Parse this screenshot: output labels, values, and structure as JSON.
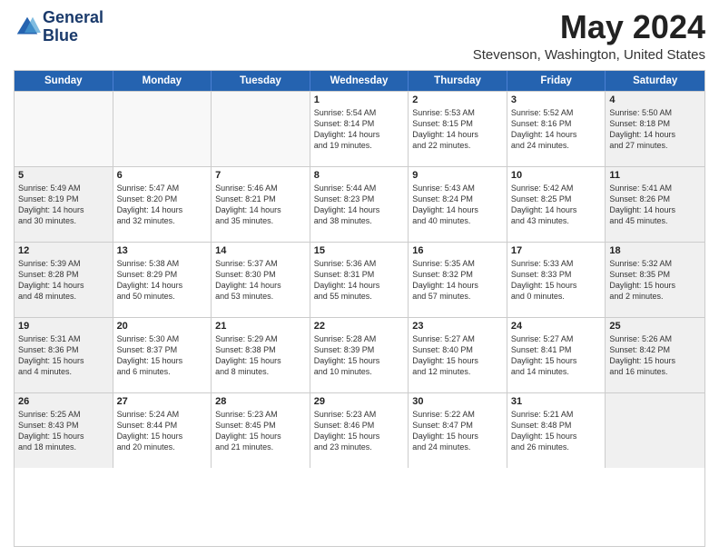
{
  "header": {
    "logo_line1": "General",
    "logo_line2": "Blue",
    "month": "May 2024",
    "location": "Stevenson, Washington, United States"
  },
  "weekdays": [
    "Sunday",
    "Monday",
    "Tuesday",
    "Wednesday",
    "Thursday",
    "Friday",
    "Saturday"
  ],
  "rows": [
    [
      {
        "day": "",
        "lines": [],
        "shaded": false
      },
      {
        "day": "",
        "lines": [],
        "shaded": false
      },
      {
        "day": "",
        "lines": [],
        "shaded": false
      },
      {
        "day": "1",
        "lines": [
          "Sunrise: 5:54 AM",
          "Sunset: 8:14 PM",
          "Daylight: 14 hours",
          "and 19 minutes."
        ],
        "shaded": false
      },
      {
        "day": "2",
        "lines": [
          "Sunrise: 5:53 AM",
          "Sunset: 8:15 PM",
          "Daylight: 14 hours",
          "and 22 minutes."
        ],
        "shaded": false
      },
      {
        "day": "3",
        "lines": [
          "Sunrise: 5:52 AM",
          "Sunset: 8:16 PM",
          "Daylight: 14 hours",
          "and 24 minutes."
        ],
        "shaded": false
      },
      {
        "day": "4",
        "lines": [
          "Sunrise: 5:50 AM",
          "Sunset: 8:18 PM",
          "Daylight: 14 hours",
          "and 27 minutes."
        ],
        "shaded": true
      }
    ],
    [
      {
        "day": "5",
        "lines": [
          "Sunrise: 5:49 AM",
          "Sunset: 8:19 PM",
          "Daylight: 14 hours",
          "and 30 minutes."
        ],
        "shaded": true
      },
      {
        "day": "6",
        "lines": [
          "Sunrise: 5:47 AM",
          "Sunset: 8:20 PM",
          "Daylight: 14 hours",
          "and 32 minutes."
        ],
        "shaded": false
      },
      {
        "day": "7",
        "lines": [
          "Sunrise: 5:46 AM",
          "Sunset: 8:21 PM",
          "Daylight: 14 hours",
          "and 35 minutes."
        ],
        "shaded": false
      },
      {
        "day": "8",
        "lines": [
          "Sunrise: 5:44 AM",
          "Sunset: 8:23 PM",
          "Daylight: 14 hours",
          "and 38 minutes."
        ],
        "shaded": false
      },
      {
        "day": "9",
        "lines": [
          "Sunrise: 5:43 AM",
          "Sunset: 8:24 PM",
          "Daylight: 14 hours",
          "and 40 minutes."
        ],
        "shaded": false
      },
      {
        "day": "10",
        "lines": [
          "Sunrise: 5:42 AM",
          "Sunset: 8:25 PM",
          "Daylight: 14 hours",
          "and 43 minutes."
        ],
        "shaded": false
      },
      {
        "day": "11",
        "lines": [
          "Sunrise: 5:41 AM",
          "Sunset: 8:26 PM",
          "Daylight: 14 hours",
          "and 45 minutes."
        ],
        "shaded": true
      }
    ],
    [
      {
        "day": "12",
        "lines": [
          "Sunrise: 5:39 AM",
          "Sunset: 8:28 PM",
          "Daylight: 14 hours",
          "and 48 minutes."
        ],
        "shaded": true
      },
      {
        "day": "13",
        "lines": [
          "Sunrise: 5:38 AM",
          "Sunset: 8:29 PM",
          "Daylight: 14 hours",
          "and 50 minutes."
        ],
        "shaded": false
      },
      {
        "day": "14",
        "lines": [
          "Sunrise: 5:37 AM",
          "Sunset: 8:30 PM",
          "Daylight: 14 hours",
          "and 53 minutes."
        ],
        "shaded": false
      },
      {
        "day": "15",
        "lines": [
          "Sunrise: 5:36 AM",
          "Sunset: 8:31 PM",
          "Daylight: 14 hours",
          "and 55 minutes."
        ],
        "shaded": false
      },
      {
        "day": "16",
        "lines": [
          "Sunrise: 5:35 AM",
          "Sunset: 8:32 PM",
          "Daylight: 14 hours",
          "and 57 minutes."
        ],
        "shaded": false
      },
      {
        "day": "17",
        "lines": [
          "Sunrise: 5:33 AM",
          "Sunset: 8:33 PM",
          "Daylight: 15 hours",
          "and 0 minutes."
        ],
        "shaded": false
      },
      {
        "day": "18",
        "lines": [
          "Sunrise: 5:32 AM",
          "Sunset: 8:35 PM",
          "Daylight: 15 hours",
          "and 2 minutes."
        ],
        "shaded": true
      }
    ],
    [
      {
        "day": "19",
        "lines": [
          "Sunrise: 5:31 AM",
          "Sunset: 8:36 PM",
          "Daylight: 15 hours",
          "and 4 minutes."
        ],
        "shaded": true
      },
      {
        "day": "20",
        "lines": [
          "Sunrise: 5:30 AM",
          "Sunset: 8:37 PM",
          "Daylight: 15 hours",
          "and 6 minutes."
        ],
        "shaded": false
      },
      {
        "day": "21",
        "lines": [
          "Sunrise: 5:29 AM",
          "Sunset: 8:38 PM",
          "Daylight: 15 hours",
          "and 8 minutes."
        ],
        "shaded": false
      },
      {
        "day": "22",
        "lines": [
          "Sunrise: 5:28 AM",
          "Sunset: 8:39 PM",
          "Daylight: 15 hours",
          "and 10 minutes."
        ],
        "shaded": false
      },
      {
        "day": "23",
        "lines": [
          "Sunrise: 5:27 AM",
          "Sunset: 8:40 PM",
          "Daylight: 15 hours",
          "and 12 minutes."
        ],
        "shaded": false
      },
      {
        "day": "24",
        "lines": [
          "Sunrise: 5:27 AM",
          "Sunset: 8:41 PM",
          "Daylight: 15 hours",
          "and 14 minutes."
        ],
        "shaded": false
      },
      {
        "day": "25",
        "lines": [
          "Sunrise: 5:26 AM",
          "Sunset: 8:42 PM",
          "Daylight: 15 hours",
          "and 16 minutes."
        ],
        "shaded": true
      }
    ],
    [
      {
        "day": "26",
        "lines": [
          "Sunrise: 5:25 AM",
          "Sunset: 8:43 PM",
          "Daylight: 15 hours",
          "and 18 minutes."
        ],
        "shaded": true
      },
      {
        "day": "27",
        "lines": [
          "Sunrise: 5:24 AM",
          "Sunset: 8:44 PM",
          "Daylight: 15 hours",
          "and 20 minutes."
        ],
        "shaded": false
      },
      {
        "day": "28",
        "lines": [
          "Sunrise: 5:23 AM",
          "Sunset: 8:45 PM",
          "Daylight: 15 hours",
          "and 21 minutes."
        ],
        "shaded": false
      },
      {
        "day": "29",
        "lines": [
          "Sunrise: 5:23 AM",
          "Sunset: 8:46 PM",
          "Daylight: 15 hours",
          "and 23 minutes."
        ],
        "shaded": false
      },
      {
        "day": "30",
        "lines": [
          "Sunrise: 5:22 AM",
          "Sunset: 8:47 PM",
          "Daylight: 15 hours",
          "and 24 minutes."
        ],
        "shaded": false
      },
      {
        "day": "31",
        "lines": [
          "Sunrise: 5:21 AM",
          "Sunset: 8:48 PM",
          "Daylight: 15 hours",
          "and 26 minutes."
        ],
        "shaded": false
      },
      {
        "day": "",
        "lines": [],
        "shaded": true
      }
    ]
  ]
}
